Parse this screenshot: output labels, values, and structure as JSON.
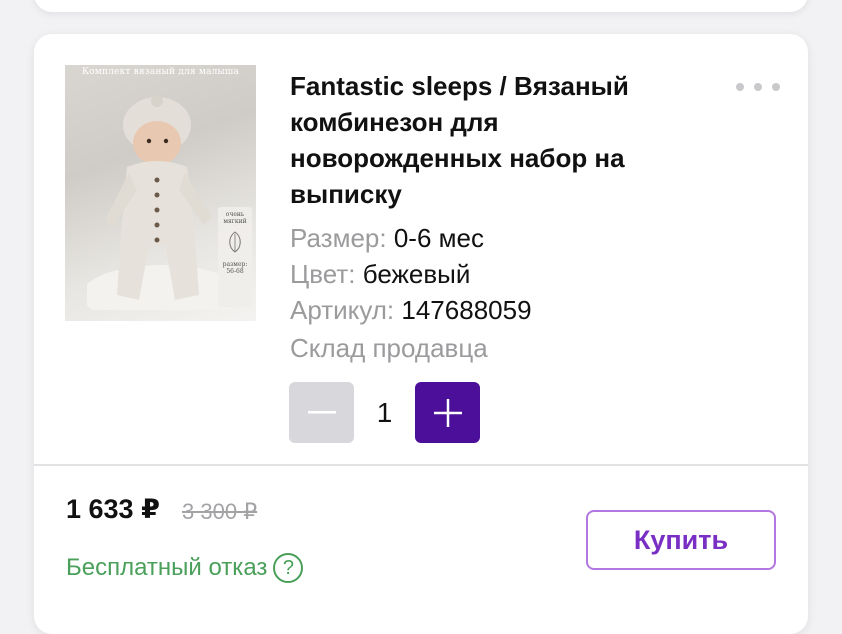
{
  "product": {
    "image_caption": "Комплект вязаный для малыша",
    "image_badge_soft": "очень мягкий",
    "image_badge_size": "размер: 56-68",
    "title": "Fantastic sleeps / Вязаный комбинезон для новорожденных набор на выписку",
    "size_label": "Размер:",
    "size_value": "0-6 мес",
    "color_label": "Цвет:",
    "color_value": "бежевый",
    "sku_label": "Артикул:",
    "sku_value": "147688059",
    "warehouse": "Склад продавца"
  },
  "menu": {
    "icon": "more-dots-icon"
  },
  "stepper": {
    "quantity": "1",
    "minus_icon": "minus-icon",
    "plus_icon": "plus-icon"
  },
  "pricing": {
    "price": "1 633 ₽",
    "old_price": "3 300 ₽",
    "free_cancel": "Бесплатный отказ",
    "help_glyph": "?"
  },
  "actions": {
    "buy_label": "Купить"
  },
  "colors": {
    "accent": "#4b0f9a",
    "buy_text": "#7a2fc4",
    "buy_border": "#b277e0",
    "green": "#4aa05a",
    "muted": "#9b9b9e"
  }
}
